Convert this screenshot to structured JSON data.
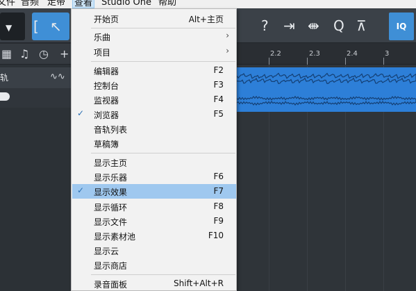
{
  "menubar": {
    "items": [
      "文件",
      "音频",
      "走带",
      "查看",
      "Studio One",
      "帮助"
    ]
  },
  "toolbar": {
    "iq_label": "IQ",
    "icons": [
      "chevron-down-icon",
      "bracket-icon",
      "pointer-icon",
      "help-icon",
      "snap-icon",
      "quantize-icon",
      "q-icon",
      "metronome-icon"
    ]
  },
  "tracks_panel": {
    "track_name": "轨",
    "track_icon": "waveform-icon"
  },
  "ruler": {
    "ticks": [
      "2.2",
      "2.3",
      "2.4",
      "3"
    ]
  },
  "view_menu": {
    "items": [
      {
        "label": "开始页",
        "shortcut": "Alt+主页"
      },
      {
        "label": "乐曲",
        "submenu": true
      },
      {
        "label": "项目",
        "submenu": true
      },
      {
        "label": "编辑器",
        "shortcut": "F2"
      },
      {
        "label": "控制台",
        "shortcut": "F3"
      },
      {
        "label": "监视器",
        "shortcut": "F4"
      },
      {
        "label": "浏览器",
        "shortcut": "F5",
        "checked": true
      },
      {
        "label": "音轨列表",
        "shortcut": ""
      },
      {
        "label": "草稿簿",
        "shortcut": ""
      },
      {
        "label": "显示主页",
        "shortcut": ""
      },
      {
        "label": "显示乐器",
        "shortcut": "F6"
      },
      {
        "label": "显示效果",
        "shortcut": "F7",
        "checked": true,
        "highlighted": true
      },
      {
        "label": "显示循环",
        "shortcut": "F8"
      },
      {
        "label": "显示文件",
        "shortcut": "F9"
      },
      {
        "label": "显示素材池",
        "shortcut": "F10"
      },
      {
        "label": "显示云",
        "shortcut": ""
      },
      {
        "label": "显示商店",
        "shortcut": ""
      },
      {
        "label": "录音面板",
        "shortcut": "Shift+Alt+R"
      }
    ],
    "check_mark": "✓",
    "submenu_arrow": "›"
  },
  "colors": {
    "accent": "#3f8fd6",
    "clip": "#2d7fd8",
    "menu_highlight": "#9fc8ef"
  }
}
